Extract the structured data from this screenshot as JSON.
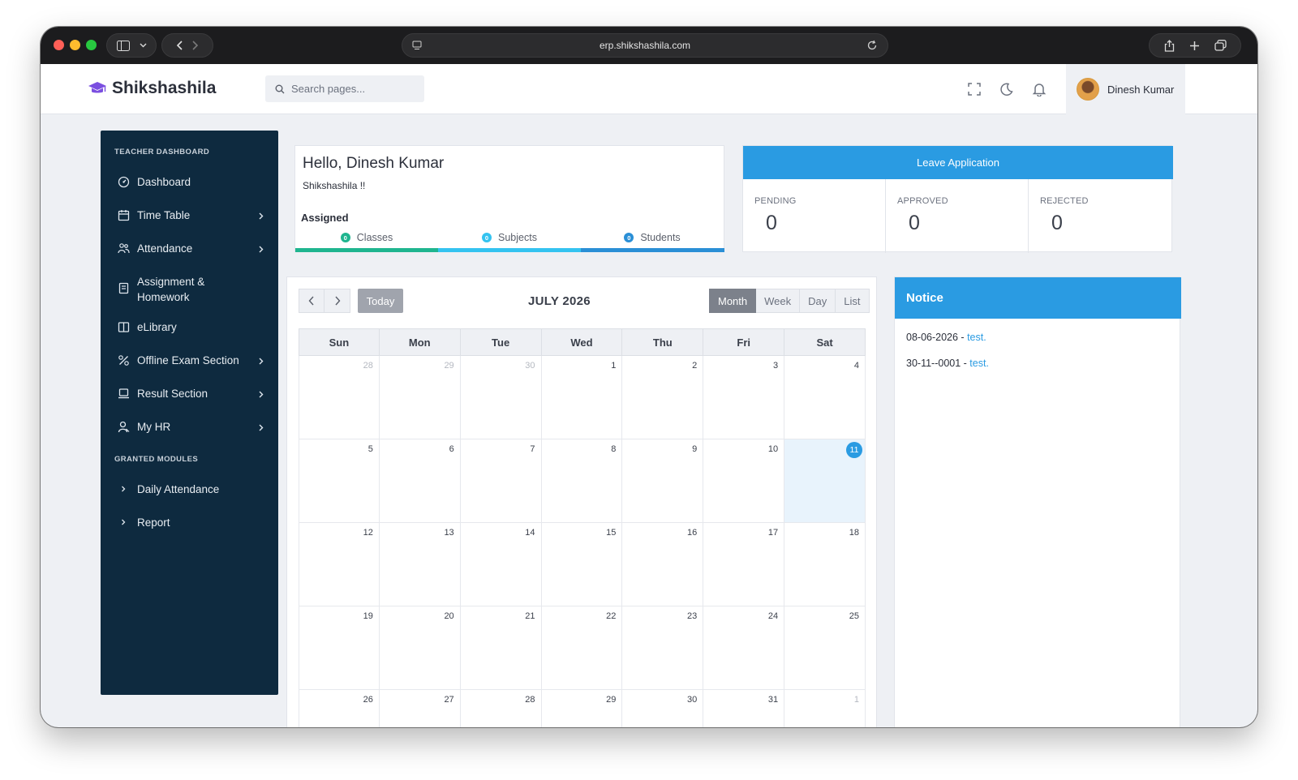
{
  "browser": {
    "url": "erp.shikshashila.com"
  },
  "header": {
    "brand": "Shikshashila",
    "search_placeholder": "Search pages...",
    "user_name": "Dinesh Kumar"
  },
  "sidebar": {
    "heading_teacher": "TEACHER DASHBOARD",
    "items": [
      {
        "label": "Dashboard",
        "icon": "dashboard-icon",
        "has_chevron": false
      },
      {
        "label": "Time Table",
        "icon": "calendar-icon",
        "has_chevron": true
      },
      {
        "label": "Attendance",
        "icon": "users-icon",
        "has_chevron": true
      },
      {
        "label": "Assignment & Homework",
        "icon": "book-icon",
        "has_chevron": false
      },
      {
        "label": "eLibrary",
        "icon": "library-icon",
        "has_chevron": false
      },
      {
        "label": "Offline Exam Section",
        "icon": "percent-icon",
        "has_chevron": true
      },
      {
        "label": "Result Section",
        "icon": "laptop-icon",
        "has_chevron": true
      },
      {
        "label": "My HR",
        "icon": "user-icon",
        "has_chevron": true
      }
    ],
    "heading_granted": "GRANTED MODULES",
    "granted": [
      {
        "label": "Daily Attendance"
      },
      {
        "label": "Report"
      }
    ]
  },
  "hello": {
    "greeting": "Hello, Dinesh Kumar",
    "subtitle": "Shikshashila !!",
    "assigned_label": "Assigned",
    "assigned": [
      {
        "label": "Classes",
        "count": "0",
        "color": "#1fb58f"
      },
      {
        "label": "Subjects",
        "count": "0",
        "color": "#34c3f0"
      },
      {
        "label": "Students",
        "count": "0",
        "color": "#2a8fd6"
      }
    ]
  },
  "leave": {
    "title": "Leave Application",
    "stats": [
      {
        "label": "PENDING",
        "value": "0"
      },
      {
        "label": "APPROVED",
        "value": "0"
      },
      {
        "label": "REJECTED",
        "value": "0"
      }
    ]
  },
  "calendar": {
    "title": "JULY 2026",
    "today_label": "Today",
    "views": [
      "Month",
      "Week",
      "Day",
      "List"
    ],
    "active_view": "Month",
    "weekdays": [
      "Sun",
      "Mon",
      "Tue",
      "Wed",
      "Thu",
      "Fri",
      "Sat"
    ],
    "weeks": [
      [
        "28",
        "29",
        "30",
        "1",
        "2",
        "3",
        "4"
      ],
      [
        "5",
        "6",
        "7",
        "8",
        "9",
        "10",
        "11"
      ],
      [
        "12",
        "13",
        "14",
        "15",
        "16",
        "17",
        "18"
      ],
      [
        "19",
        "20",
        "21",
        "22",
        "23",
        "24",
        "25"
      ],
      [
        "26",
        "27",
        "28",
        "29",
        "30",
        "31",
        "1"
      ]
    ],
    "other_month": [
      [
        0,
        0
      ],
      [
        0,
        1
      ],
      [
        0,
        2
      ],
      [
        4,
        6
      ]
    ],
    "today_cell": [
      1,
      6
    ]
  },
  "notice": {
    "title": "Notice",
    "items": [
      {
        "date": "08-06-2026",
        "text": "test."
      },
      {
        "date": "30-11--0001",
        "text": "test."
      }
    ]
  },
  "colors": {
    "accent": "#2a9be2",
    "sidebar_bg": "#0e2a3f",
    "brand_icon": "#7b4fe0"
  }
}
